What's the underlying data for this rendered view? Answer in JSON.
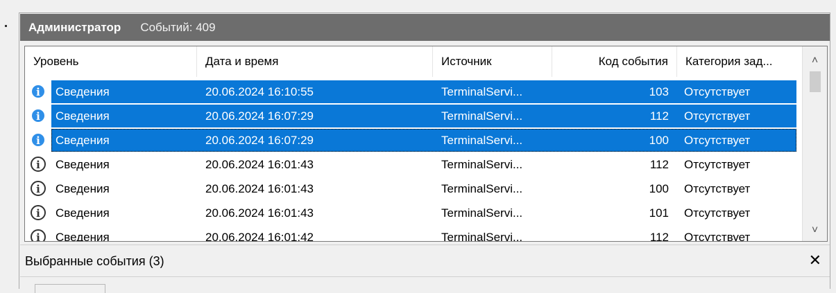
{
  "header": {
    "title": "Администратор",
    "events_count": "Событий: 409"
  },
  "table": {
    "columns": [
      "Уровень",
      "Дата и время",
      "Источник",
      "Код события",
      "Категория зад..."
    ],
    "rows": [
      {
        "level": "Сведения",
        "datetime": "20.06.2024 16:10:55",
        "source": "TerminalServi...",
        "code": "103",
        "category": "Отсутствует",
        "selected": true
      },
      {
        "level": "Сведения",
        "datetime": "20.06.2024 16:07:29",
        "source": "TerminalServi...",
        "code": "112",
        "category": "Отсутствует",
        "selected": true
      },
      {
        "level": "Сведения",
        "datetime": "20.06.2024 16:07:29",
        "source": "TerminalServi...",
        "code": "100",
        "category": "Отсутствует",
        "selected": true,
        "focused": true
      },
      {
        "level": "Сведения",
        "datetime": "20.06.2024 16:01:43",
        "source": "TerminalServi...",
        "code": "112",
        "category": "Отсутствует",
        "selected": false
      },
      {
        "level": "Сведения",
        "datetime": "20.06.2024 16:01:43",
        "source": "TerminalServi...",
        "code": "100",
        "category": "Отсутствует",
        "selected": false
      },
      {
        "level": "Сведения",
        "datetime": "20.06.2024 16:01:43",
        "source": "TerminalServi...",
        "code": "101",
        "category": "Отсутствует",
        "selected": false
      },
      {
        "level": "Сведения",
        "datetime": "20.06.2024 16:01:42",
        "source": "TerminalServi...",
        "code": "112",
        "category": "Отсутствует",
        "selected": false
      }
    ]
  },
  "info_icon_glyph": "i",
  "selected_panel": {
    "title": "Выбранные события (3)",
    "close_glyph": "✕"
  },
  "scroll": {
    "up_glyph": "˄",
    "down_glyph": "˅"
  },
  "colors": {
    "selection": "#0a78d7",
    "header_bar": "#6d6d6d"
  }
}
